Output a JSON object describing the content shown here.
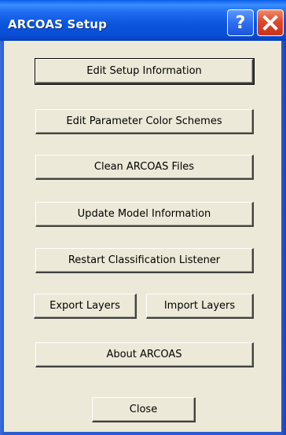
{
  "window": {
    "title": "ARCOAS Setup",
    "help_glyph": "?",
    "close_glyph": "✕"
  },
  "buttons": {
    "edit_setup": "Edit Setup Information",
    "edit_colors": "Edit Parameter Color Schemes",
    "clean_files": "Clean ARCOAS Files",
    "update_model": "Update Model Information",
    "restart_listener": "Restart Classification Listener",
    "export_layers": "Export Layers",
    "import_layers": "Import Layers",
    "about": "About ARCOAS",
    "close": "Close"
  },
  "colors": {
    "title_bar": "#0a54dd",
    "dialog_face": "#ece9d8",
    "close_button": "#e0482a"
  }
}
